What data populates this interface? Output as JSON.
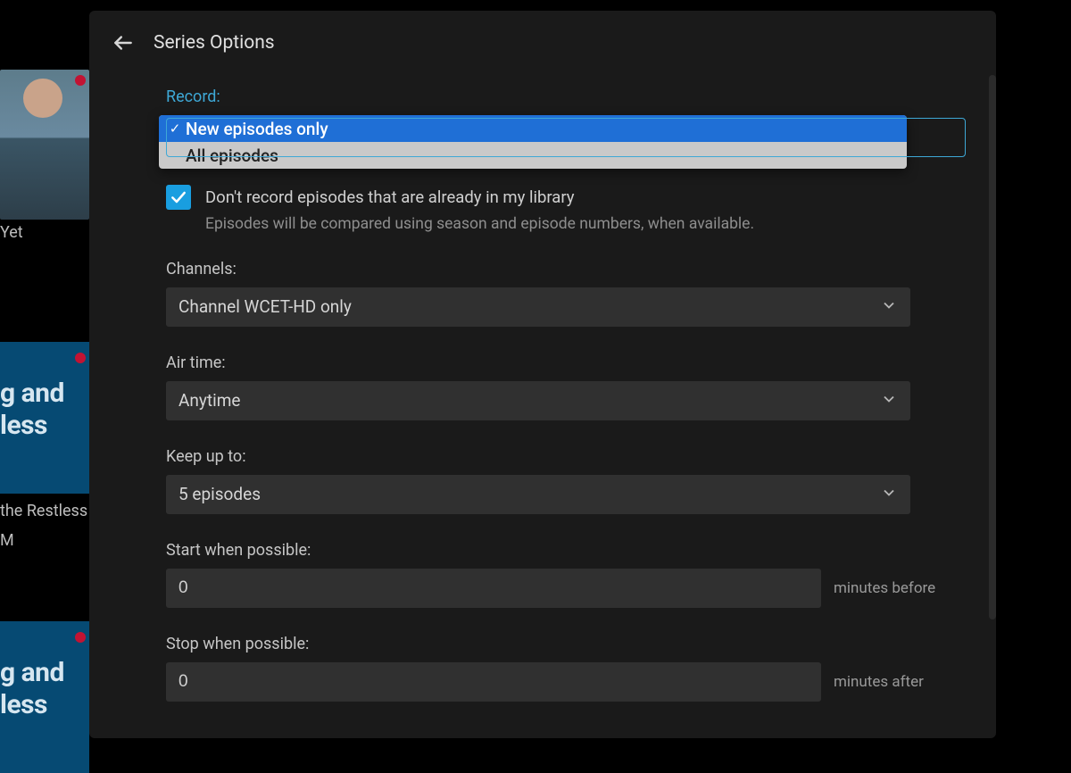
{
  "background": {
    "sub1": "Yet",
    "card_text_line1": "g and",
    "card_text_line2": "less",
    "sub2": "the Restless",
    "sub3": "M"
  },
  "header": {
    "title": "Series Options"
  },
  "form": {
    "record": {
      "label": "Record:",
      "options": {
        "selected": "New episodes only",
        "other": "All episodes"
      }
    },
    "skip_library": {
      "text": "Don't record episodes that are already in my library",
      "subtext": "Episodes will be compared using season and episode numbers, when available.",
      "checked": true
    },
    "channels": {
      "label": "Channels:",
      "value": "Channel WCET-HD only"
    },
    "airtime": {
      "label": "Air time:",
      "value": "Anytime"
    },
    "keep": {
      "label": "Keep up to:",
      "value": "5 episodes"
    },
    "start": {
      "label": "Start when possible:",
      "value": "0",
      "suffix": "minutes before"
    },
    "stop": {
      "label": "Stop when possible:",
      "value": "0",
      "suffix": "minutes after"
    }
  }
}
